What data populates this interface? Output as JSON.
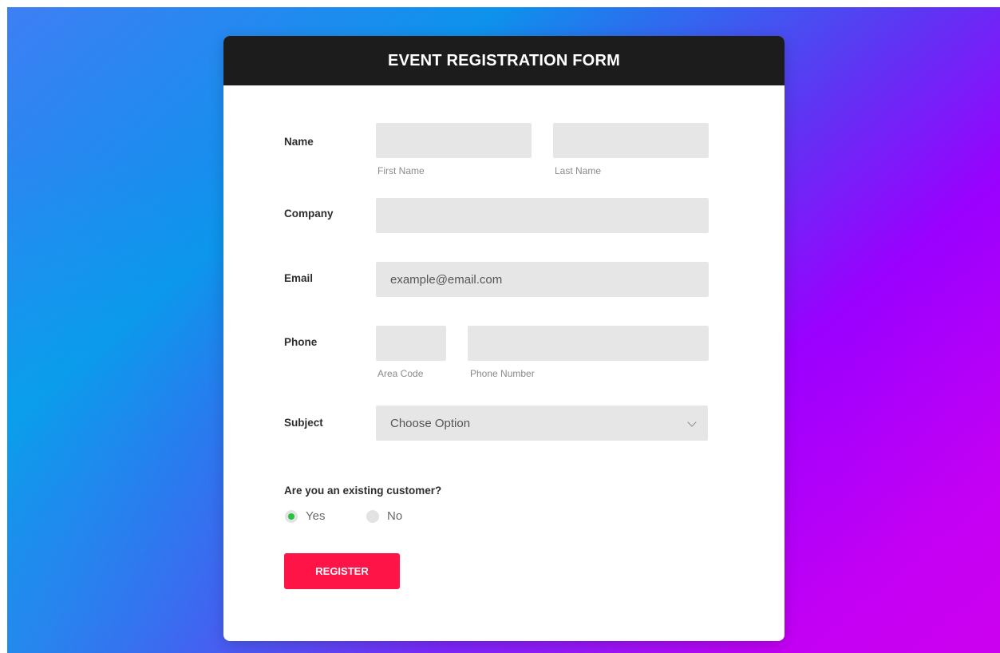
{
  "form": {
    "title": "EVENT REGISTRATION FORM",
    "name": {
      "label": "Name",
      "first_value": "",
      "first_sublabel": "First Name",
      "last_value": "",
      "last_sublabel": "Last Name"
    },
    "company": {
      "label": "Company",
      "value": ""
    },
    "email": {
      "label": "Email",
      "placeholder": "example@email.com"
    },
    "phone": {
      "label": "Phone",
      "area_value": "",
      "area_sublabel": "Area Code",
      "number_value": "",
      "number_sublabel": "Phone Number"
    },
    "subject": {
      "label": "Subject",
      "selected": "Choose Option"
    },
    "customer_question": {
      "text": "Are you an existing customer?",
      "options": [
        {
          "label": "Yes",
          "selected": true
        },
        {
          "label": "No",
          "selected": false
        }
      ]
    },
    "register_label": "REGISTER"
  },
  "icons": {
    "subject_dropdown": "chevron-down-icon"
  },
  "colors": {
    "header_bg": "#1c1c1c",
    "field_bg": "#e6e6e6",
    "register_button": "#ff1447",
    "radio_selected": "#27c23f"
  }
}
